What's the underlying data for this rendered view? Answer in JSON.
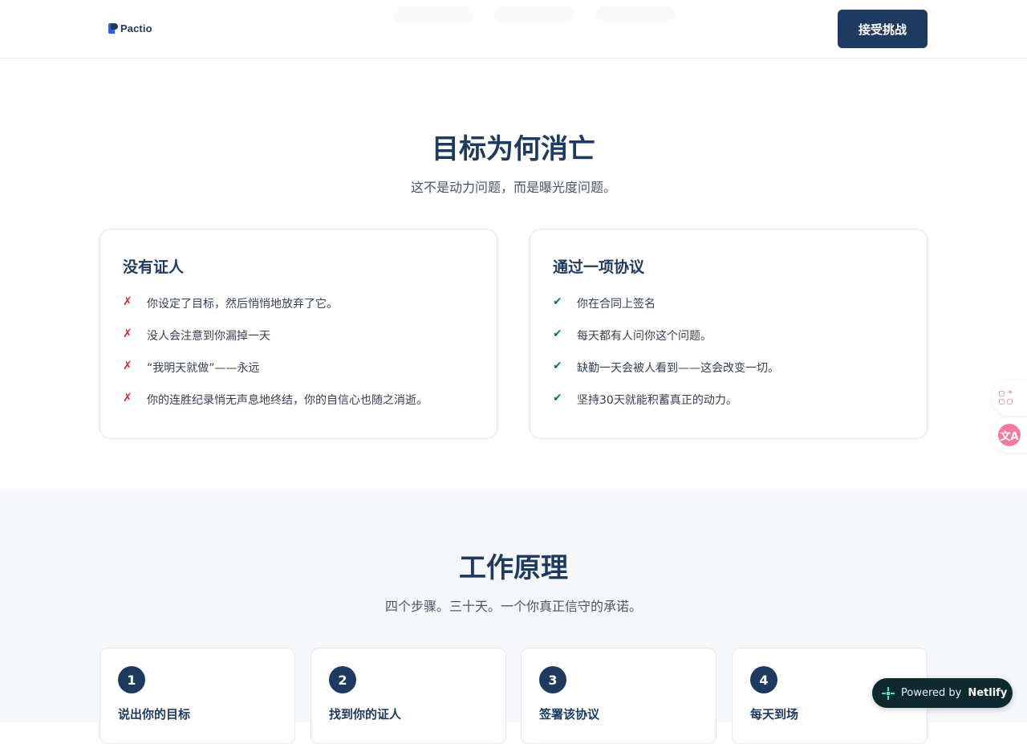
{
  "header": {
    "logo_text": "Pactio",
    "cta_label": "接受挑战"
  },
  "why": {
    "title": "目标为何消亡",
    "subtitle": "这不是动力问题，而是曝光度问题。",
    "without": {
      "title": "没有证人",
      "mark": "✗",
      "items": [
        "你设定了目标，然后悄悄地放弃了它。",
        "没人会注意到你漏掉一天",
        "“我明天就做”——永远",
        "你的连胜纪录悄无声息地终结，你的自信心也随之消逝。"
      ]
    },
    "with": {
      "title": "通过一项协议",
      "mark": "✔",
      "items": [
        "你在合同上签名",
        "每天都有人问你这个问题。",
        "缺勤一天会被人看到——这会改变一切。",
        "坚持30天就能积蓄真正的动力。"
      ]
    }
  },
  "how": {
    "title": "工作原理",
    "subtitle": "四个步骤。三十天。一个你真正信守的承诺。",
    "steps": [
      {
        "num": "1",
        "title": "说出你的目标"
      },
      {
        "num": "2",
        "title": "找到你的证人"
      },
      {
        "num": "3",
        "title": "签署该协议"
      },
      {
        "num": "4",
        "title": "每天到场"
      }
    ]
  },
  "side_widgets": {
    "apps_icon": "apps-sparkle-icon",
    "translate_icon": "translate-icon",
    "translate_glyph": "文A"
  },
  "netlify": {
    "prefix": "Powered by",
    "brand": "Netlify"
  },
  "colors": {
    "primary": "#1e3a5f",
    "cross": "#dc2626",
    "check": "#0f766e",
    "section_bg": "#f5f7fb"
  }
}
